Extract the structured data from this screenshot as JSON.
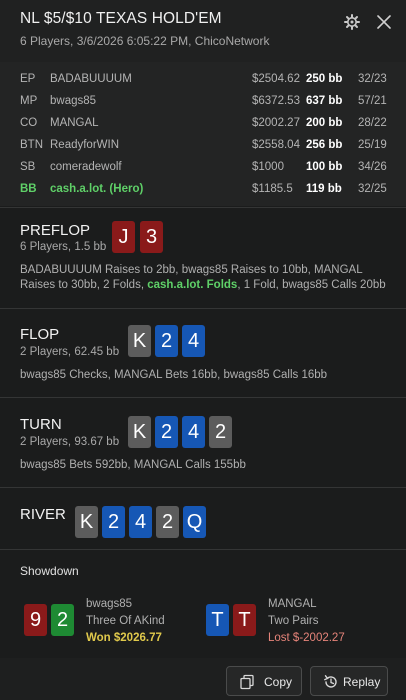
{
  "header": {
    "title": "NL $5/$10 TEXAS HOLD'EM",
    "subtitle": "6 Players, 3/6/2026 6:05:22 PM, ChicoNetwork"
  },
  "players": [
    {
      "pos": "EP",
      "name": "BADABUUUUM",
      "stack": "$2504.62",
      "bb": "250 bb",
      "stat": "32/23",
      "hero": false
    },
    {
      "pos": "MP",
      "name": "bwags85",
      "stack": "$6372.53",
      "bb": "637 bb",
      "stat": "57/21",
      "hero": false
    },
    {
      "pos": "CO",
      "name": "MANGAL",
      "stack": "$2002.27",
      "bb": "200 bb",
      "stat": "28/22",
      "hero": false
    },
    {
      "pos": "BTN",
      "name": "ReadyforWIN",
      "stack": "$2558.04",
      "bb": "256 bb",
      "stat": "25/19",
      "hero": false
    },
    {
      "pos": "SB",
      "name": "comeradewolf",
      "stack": "$1000",
      "bb": "100 bb",
      "stat": "34/26",
      "hero": false
    },
    {
      "pos": "BB",
      "name": "cash.a.lot. (Hero)",
      "stack": "$1185.5",
      "bb": "119 bb",
      "stat": "32/25",
      "hero": true
    }
  ],
  "preflop": {
    "name": "PREFLOP",
    "info": "6 Players, 1.5 bb",
    "desc_a": "BADABUUUUM Raises to 2bb, bwags85 Raises to 10bb, MANGAL Raises to 30bb, 2 Folds,",
    "desc_hero": "cash.a.lot. Folds",
    "desc_b": ", 1 Fold, bwags85 Calls 20bb",
    "cards": [
      {
        "rank": "J",
        "color": "red"
      },
      {
        "rank": "3",
        "color": "red"
      }
    ]
  },
  "flop": {
    "name": "FLOP",
    "info": "2 Players, 62.45 bb",
    "desc": "bwags85 Checks, MANGAL Bets 16bb, bwags85 Calls 16bb",
    "cards": [
      {
        "rank": "K",
        "color": "gray"
      },
      {
        "rank": "2",
        "color": "blue"
      },
      {
        "rank": "4",
        "color": "blue"
      }
    ]
  },
  "turn": {
    "name": "TURN",
    "info": "2 Players, 93.67 bb",
    "desc": "bwags85 Bets 592bb, MANGAL Calls 155bb",
    "cards": [
      {
        "rank": "K",
        "color": "gray"
      },
      {
        "rank": "2",
        "color": "blue"
      },
      {
        "rank": "4",
        "color": "blue"
      },
      {
        "rank": "2",
        "color": "gray"
      }
    ]
  },
  "river": {
    "name": "RIVER",
    "cards": [
      {
        "rank": "K",
        "color": "gray"
      },
      {
        "rank": "2",
        "color": "blue"
      },
      {
        "rank": "4",
        "color": "blue"
      },
      {
        "rank": "2",
        "color": "gray"
      },
      {
        "rank": "Q",
        "color": "blue"
      }
    ]
  },
  "showdown": {
    "title": "Showdown",
    "left": {
      "name": "bwags85",
      "hand": "Three Of AKind",
      "result": "Won $2026.77",
      "cards": [
        {
          "rank": "9",
          "color": "red"
        },
        {
          "rank": "2",
          "color": "green"
        }
      ]
    },
    "right": {
      "name": "MANGAL",
      "hand": "Two Pairs",
      "result": "Lost $-2002.27",
      "cards": [
        {
          "rank": "T",
          "color": "blue"
        },
        {
          "rank": "T",
          "color": "red"
        }
      ]
    }
  },
  "footer": {
    "copy_label": "Copy",
    "replay_label": "Replay"
  },
  "colors": {
    "hero": "#5fd068",
    "won": "#e0c94c",
    "lost": "#e6847a",
    "card_red": "#8a1a1a",
    "card_gray": "#5c5c5c",
    "card_blue": "#1657b5",
    "card_green": "#1e8a33"
  },
  "icons": {
    "settings": "gear-icon",
    "close": "close-icon",
    "copy": "copy-icon",
    "replay": "replay-icon"
  }
}
